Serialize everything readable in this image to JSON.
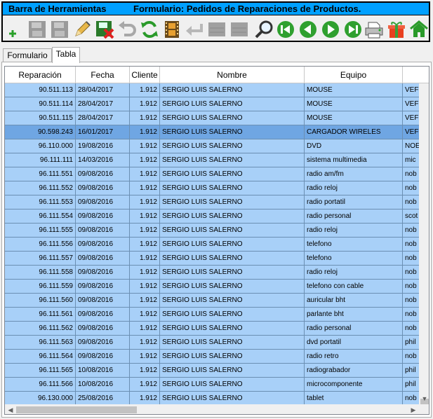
{
  "titlebar": {
    "left_title": "Barra de Herramientas",
    "form_title": "Formulario: Pedidos de Reparaciones de Productos."
  },
  "toolbar": {
    "tools": [
      {
        "name": "add-record",
        "icon": "plus-icon",
        "enabled": false
      },
      {
        "name": "save-record",
        "icon": "floppy-icon",
        "enabled": false
      },
      {
        "name": "save-copy",
        "icon": "floppy-icon",
        "enabled": false
      },
      {
        "name": "edit-record",
        "icon": "pencil-icon",
        "enabled": true
      },
      {
        "name": "delete-record",
        "icon": "floppy-delete-icon",
        "enabled": true
      },
      {
        "name": "undo",
        "icon": "undo-arrow-icon",
        "enabled": false
      },
      {
        "name": "refresh",
        "icon": "refresh-icon",
        "enabled": true
      },
      {
        "name": "report",
        "icon": "film-icon",
        "enabled": true
      },
      {
        "name": "return",
        "icon": "return-arrow-icon",
        "enabled": false
      },
      {
        "name": "blank-1",
        "icon": "blank-icon",
        "enabled": false
      },
      {
        "name": "blank-2",
        "icon": "blank-icon",
        "enabled": false
      },
      {
        "name": "search",
        "icon": "magnifier-icon",
        "enabled": true
      },
      {
        "name": "first-record",
        "icon": "first-icon",
        "enabled": true
      },
      {
        "name": "previous-record",
        "icon": "previous-icon",
        "enabled": true
      },
      {
        "name": "next-record",
        "icon": "next-icon",
        "enabled": true
      },
      {
        "name": "last-record",
        "icon": "last-icon",
        "enabled": true
      },
      {
        "name": "print",
        "icon": "printer-icon",
        "enabled": true
      },
      {
        "name": "gift",
        "icon": "gift-icon",
        "enabled": true
      },
      {
        "name": "home",
        "icon": "home-icon",
        "enabled": true
      }
    ]
  },
  "tabs": [
    {
      "label": "Formulario",
      "active": false
    },
    {
      "label": "Tabla",
      "active": true
    }
  ],
  "grid": {
    "columns": [
      "Reparación",
      "Fecha",
      "Cliente",
      "Nombre",
      "Equipo",
      ""
    ],
    "rows": [
      [
        "90.511.113",
        "28/04/2017",
        "1.912",
        "SERGIO LUIS SALERNO",
        "MOUSE",
        "VEF"
      ],
      [
        "90.511.114",
        "28/04/2017",
        "1.912",
        "SERGIO LUIS SALERNO",
        "MOUSE",
        "VEF"
      ],
      [
        "90.511.115",
        "28/04/2017",
        "1.912",
        "SERGIO LUIS SALERNO",
        "MOUSE",
        "VEF"
      ],
      [
        "90.598.243",
        "16/01/2017",
        "1.912",
        "SERGIO LUIS SALERNO",
        "CARGADOR WIRELES",
        "VEF"
      ],
      [
        "96.110.000",
        "19/08/2016",
        "1.912",
        "SERGIO LUIS SALERNO",
        "DVD",
        "NOE"
      ],
      [
        "96.111.111",
        "14/03/2016",
        "1.912",
        "SERGIO LUIS SALERNO",
        "sistema multimedia",
        "mic"
      ],
      [
        "96.111.551",
        "09/08/2016",
        "1.912",
        "SERGIO LUIS SALERNO",
        "radio am/fm",
        "nob"
      ],
      [
        "96.111.552",
        "09/08/2016",
        "1.912",
        "SERGIO LUIS SALERNO",
        "radio reloj",
        "nob"
      ],
      [
        "96.111.553",
        "09/08/2016",
        "1.912",
        "SERGIO LUIS SALERNO",
        "radio portatil",
        "nob"
      ],
      [
        "96.111.554",
        "09/08/2016",
        "1.912",
        "SERGIO LUIS SALERNO",
        "radio personal",
        "scot"
      ],
      [
        "96.111.555",
        "09/08/2016",
        "1.912",
        "SERGIO LUIS SALERNO",
        "radio reloj",
        "nob"
      ],
      [
        "96.111.556",
        "09/08/2016",
        "1.912",
        "SERGIO LUIS SALERNO",
        "telefono",
        "nob"
      ],
      [
        "96.111.557",
        "09/08/2016",
        "1.912",
        "SERGIO LUIS SALERNO",
        "telefono",
        "nob"
      ],
      [
        "96.111.558",
        "09/08/2016",
        "1.912",
        "SERGIO LUIS SALERNO",
        "radio reloj",
        "nob"
      ],
      [
        "96.111.559",
        "09/08/2016",
        "1.912",
        "SERGIO LUIS SALERNO",
        "telefono con cable",
        "nob"
      ],
      [
        "96.111.560",
        "09/08/2016",
        "1.912",
        "SERGIO LUIS SALERNO",
        "auricular bht",
        "nob"
      ],
      [
        "96.111.561",
        "09/08/2016",
        "1.912",
        "SERGIO LUIS SALERNO",
        "parlante bht",
        "nob"
      ],
      [
        "96.111.562",
        "09/08/2016",
        "1.912",
        "SERGIO LUIS SALERNO",
        "radio personal",
        "nob"
      ],
      [
        "96.111.563",
        "09/08/2016",
        "1.912",
        "SERGIO LUIS SALERNO",
        "dvd portatil",
        "phil"
      ],
      [
        "96.111.564",
        "09/08/2016",
        "1.912",
        "SERGIO LUIS SALERNO",
        "radio retro",
        "nob"
      ],
      [
        "96.111.565",
        "10/08/2016",
        "1.912",
        "SERGIO LUIS SALERNO",
        "radiograbador",
        "phil"
      ],
      [
        "96.111.566",
        "10/08/2016",
        "1.912",
        "SERGIO LUIS SALERNO",
        "microcomponente",
        "phil"
      ],
      [
        "96.130.000",
        "25/08/2016",
        "1.912",
        "SERGIO LUIS SALERNO",
        "tablet",
        "nob"
      ]
    ],
    "selected_row_index": 3
  },
  "colors": {
    "title_bg": "#00a0ff",
    "row_bg": "#a8d0f8",
    "row_selected_bg": "#6fa6e3"
  }
}
